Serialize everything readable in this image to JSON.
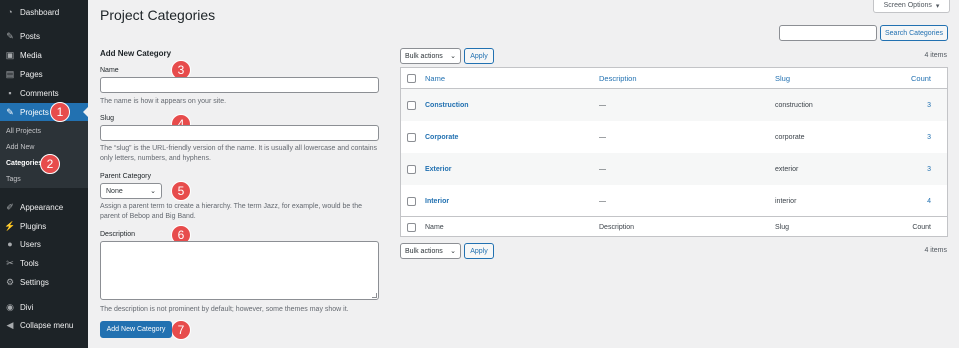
{
  "sidebar": {
    "items": [
      {
        "label": "Dashboard",
        "icon": "dashboard-icon"
      },
      {
        "label": "Posts",
        "icon": "pushpin-icon"
      },
      {
        "label": "Media",
        "icon": "media-icon"
      },
      {
        "label": "Pages",
        "icon": "pages-icon"
      },
      {
        "label": "Comments",
        "icon": "comments-icon"
      },
      {
        "label": "Projects",
        "icon": "pushpin-icon"
      },
      {
        "label": "Appearance",
        "icon": "paintbrush-icon"
      },
      {
        "label": "Plugins",
        "icon": "plugin-icon"
      },
      {
        "label": "Users",
        "icon": "users-icon"
      },
      {
        "label": "Tools",
        "icon": "wrench-icon"
      },
      {
        "label": "Settings",
        "icon": "settings-icon"
      },
      {
        "label": "Divi",
        "icon": "divi-icon"
      },
      {
        "label": "Collapse menu",
        "icon": "collapse-icon"
      }
    ],
    "submenu": [
      "All Projects",
      "Add New",
      "Categories",
      "Tags"
    ]
  },
  "badges": [
    "1",
    "2",
    "3",
    "4",
    "5",
    "6",
    "7"
  ],
  "header": {
    "title": "Project Categories",
    "screen_options": "Screen Options",
    "screen_options_caret": "▾"
  },
  "form": {
    "heading": "Add New Category",
    "name_label": "Name",
    "name_value": "",
    "name_help": "The name is how it appears on your site.",
    "slug_label": "Slug",
    "slug_value": "",
    "slug_help": "The “slug” is the URL-friendly version of the name. It is usually all lowercase and contains only letters, numbers, and hyphens.",
    "parent_label": "Parent Category",
    "parent_value": "None",
    "parent_help": "Assign a parent term to create a hierarchy. The term Jazz, for example, would be the parent of Bebop and Big Band.",
    "description_label": "Description",
    "description_help": "The description is not prominent by default; however, some themes may show it.",
    "submit_label": "Add New Category"
  },
  "list": {
    "search_value": "",
    "search_button": "Search Categories",
    "bulk_actions": "Bulk actions",
    "apply": "Apply",
    "items_count": "4 items",
    "columns": [
      "Name",
      "Description",
      "Slug",
      "Count"
    ],
    "rows": [
      {
        "name": "Construction",
        "description": "—",
        "slug": "construction",
        "count": "3"
      },
      {
        "name": "Corporate",
        "description": "—",
        "slug": "corporate",
        "count": "3"
      },
      {
        "name": "Exterior",
        "description": "—",
        "slug": "exterior",
        "count": "3"
      },
      {
        "name": "Interior",
        "description": "—",
        "slug": "interior",
        "count": "4"
      }
    ]
  },
  "colors": {
    "sidebar_bg": "#1d2327",
    "accent": "#2271b1",
    "badge": "#e74c4c"
  }
}
